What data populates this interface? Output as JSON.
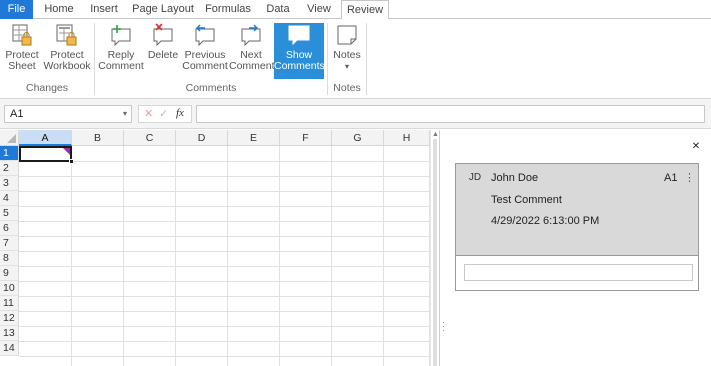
{
  "tabs": [
    {
      "label": "File"
    },
    {
      "label": "Home"
    },
    {
      "label": "Insert"
    },
    {
      "label": "Page Layout"
    },
    {
      "label": "Formulas"
    },
    {
      "label": "Data"
    },
    {
      "label": "View"
    },
    {
      "label": "Review"
    }
  ],
  "active_tab": "Review",
  "ribbon": {
    "changes_group": "Changes",
    "comments_group": "Comments",
    "notes_group": "Notes",
    "protect_sheet": [
      "Protect",
      "Sheet"
    ],
    "protect_workbook": [
      "Protect",
      "Workbook"
    ],
    "reply_comment": [
      "Reply",
      "Comment"
    ],
    "delete": "Delete",
    "previous_comment": [
      "Previous",
      "Comment"
    ],
    "next_comment": [
      "Next",
      "Comment"
    ],
    "show_comments": [
      "Show",
      "Comments"
    ],
    "notes": "Notes",
    "notes_dropdown": "▾"
  },
  "formula_bar": {
    "name_box": "A1",
    "name_box_dropdown": "▾",
    "cancel_glyph": "✕",
    "enter_glyph": "✓",
    "fx_label": "fx",
    "value": ""
  },
  "sheet": {
    "columns": [
      "A",
      "B",
      "C",
      "D",
      "E",
      "F",
      "G",
      "H"
    ],
    "rows": [
      "1",
      "2",
      "3",
      "4",
      "5",
      "6",
      "7",
      "8",
      "9",
      "10",
      "11",
      "12",
      "13",
      "14"
    ],
    "selected_column": "A",
    "selected_row": "1",
    "comment_marker_color": "#9b2fae"
  },
  "comments_pane": {
    "close_glyph": "✕",
    "comment": {
      "initials": "JD",
      "author": "John Doe",
      "cell": "A1",
      "menu_glyph": "⋮",
      "text": "Test Comment",
      "date": "4/29/2022 6:13:00 PM"
    },
    "reply_placeholder": ""
  },
  "colors": {
    "file_tab": "#1e7ad6",
    "show_comments_active": "#2a8fd8",
    "selection": "#1e7ad6",
    "comment_card": "#d9d9d9"
  }
}
